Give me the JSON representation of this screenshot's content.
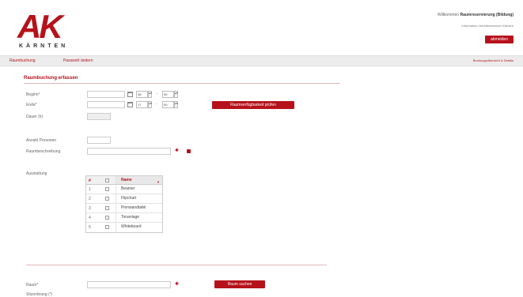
{
  "header": {
    "logo_main": "AK",
    "logo_sub": "KÄRNTEN",
    "welcome_prefix": "Willkommen",
    "welcome_name": "Raumreservierung (Bildung)",
    "sub_info": "Information: Arbeiterkammer Kärnten",
    "logout_label": "abmelden"
  },
  "nav": {
    "items": [
      "Raumbuchung",
      "Passwort ändern"
    ],
    "right_link": "Buchungsübersicht & Details"
  },
  "form": {
    "section_title": "Raumbuchung erfassen",
    "begin_label": "Beginn*",
    "end_label": "Ende*",
    "duration_label": "Dauer (h)",
    "begin_hour": "08",
    "begin_min": "00",
    "end_hour": "17",
    "end_min": "00",
    "check_button": "Raumverfügbarkeit prüfen",
    "persons_label": "Anzahl Personen",
    "description_label": "Raumbeschreibung",
    "features_label": "Ausstattung"
  },
  "grid": {
    "header_num": "#",
    "header_name": "Name",
    "rows": [
      {
        "num": "1",
        "name": "Beamer"
      },
      {
        "num": "2",
        "name": "Flipchart"
      },
      {
        "num": "3",
        "name": "Pinnwandtafel"
      },
      {
        "num": "4",
        "name": "Tonanlage"
      },
      {
        "num": "5",
        "name": "Whiteboard"
      }
    ]
  },
  "search": {
    "room_label": "Raum*",
    "search_button": "Raum suchen",
    "next_label": "Sitzordnung (*)"
  },
  "colors": {
    "accent": "#b5121b",
    "nav_bg": "#ececec"
  }
}
